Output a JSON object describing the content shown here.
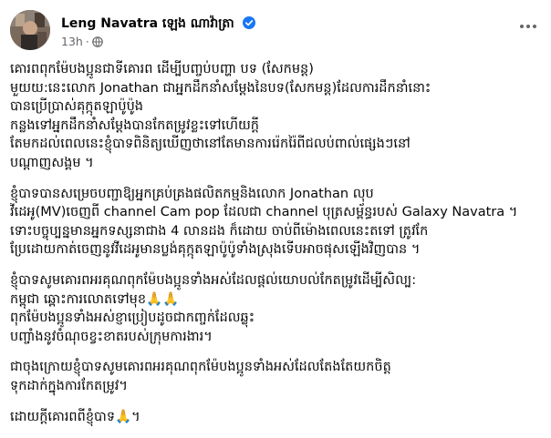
{
  "post": {
    "author": "Leng Navatra ឡេង ណាវ៉ាត្រា",
    "time": "13h",
    "dot": "·",
    "colors": {
      "verified": "#1877f2",
      "meta": "#65676b",
      "text": "#050505"
    },
    "icons": {
      "verified": "verified-badge-icon",
      "audience": "globe-icon",
      "menu": "more-options-icon"
    },
    "paragraphs": [
      {
        "lines": [
          "គោរពពុកម៉ែបងប្អូនជាទីគោរព ដើម្បីបញ្ចប់បញ្ហា បទ (សែកមន្ត)",
          "មួយយ:នេះលោក Jonathan ជាអ្នកដឹកនាំសម្តែងនៃបទ(សែកមន្ត)ដែលការដឹកនាំនោះ",
          "បានប្រើប្រាស់គុក្កុតឡាប៉ូប៉ូង",
          " កន្លងទៅអ្នកដឹកនាំសម្តែងបានកែតម្រូវខ្លះទៅហើយក្តី",
          " តែមកដល់ពេលនេះខ្ញុំបាទពិនិត្យឃើញថានៅតែមានការរ៉េករ៉ៃពីជលប់ពាល់ផ្សេងៗនៅ",
          "បណ្តាញសង្គម ។"
        ]
      },
      {
        "lines": [
          "ខ្ញុំបាទបានសម្រេចបញ្ជាឱ្យអ្នកគ្រប់គ្រងផលិតកម្មនិងលោក Jonathan លុប",
          "វីដេអូ(MV)ចេញពី channel Cam pop ដែលជា channel បុត្រសម្ព័ន្ធរបស់ Galaxy Navatra ។",
          "ទោះបច្ចុប្បន្នមានអ្នកទស្សនាជាង 4 លានដង ក៏ដោយ ចាប់ពីម៉ោងពេលនេះតទៅ ត្រូវកែ",
          "ប្រែដោយកាត់ចេញនូវវីដេអូមានប្លង់គុក្កុតឡាប៉ូប៉ូទាំងស្រុងទើបអាចផុសឡើងវិញបាន ។"
        ]
      },
      {
        "lines": [
          "ខ្ញុំបាទសូមគោរពអរគុណពុកម៉ែបងប្អូនទាំងអស់ដែលផ្តល់យោបល់កែតម្រូវដើម្បីសិល្ប:",
          "កម្ពុជា ឆ្ពោះការលោតទៅមុខ🙏🙏",
          "ពុកម៉ែបងប្អូនទាំងអស់ខ្ញាប្រៀបដូចជាកញ្ចក់ដែលឆ្លុះ",
          "បញ្ចាំងនូវចំណុចខ្វះខាតរបស់ក្រុមការងារ។"
        ]
      },
      {
        "lines": [
          "ជាចុងក្រោយខ្ញុំបាទសូមគោរពអរគុណពុកម៉ែបងប្អូនទាំងអស់ដែលតែងតែយកចិត្ត",
          "ទុកដាក់ក្នុងការកែតម្រូវ។"
        ]
      },
      {
        "lines": [
          "ដោយក្តីគោរពពីខ្ញុំបាទ🙏។"
        ]
      }
    ]
  }
}
